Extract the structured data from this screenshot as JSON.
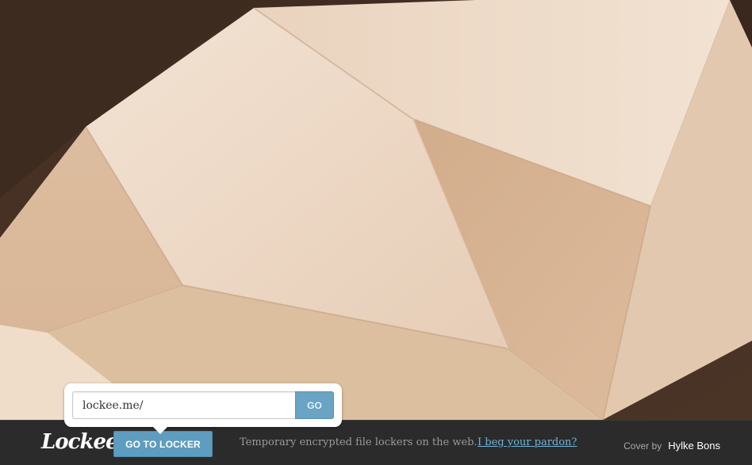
{
  "brand": {
    "logo_text": "Lockee"
  },
  "locker_form": {
    "url_value": "lockee.me/",
    "go_label": "GO"
  },
  "bottom_bar": {
    "go_to_locker_label": "GO TO LOCKER",
    "tagline": "Temporary encrypted file lockers on the web.",
    "pardon_link": "I beg your pardon?",
    "credit_prefix": "Cover by",
    "credit_author": "Hylke Bons"
  },
  "colors": {
    "accent": "#5e9dbf",
    "link": "#6fb3d8",
    "bar_background": "#2b2b2b"
  },
  "icons": {
    "popover_pointer": "caret-down-icon"
  }
}
